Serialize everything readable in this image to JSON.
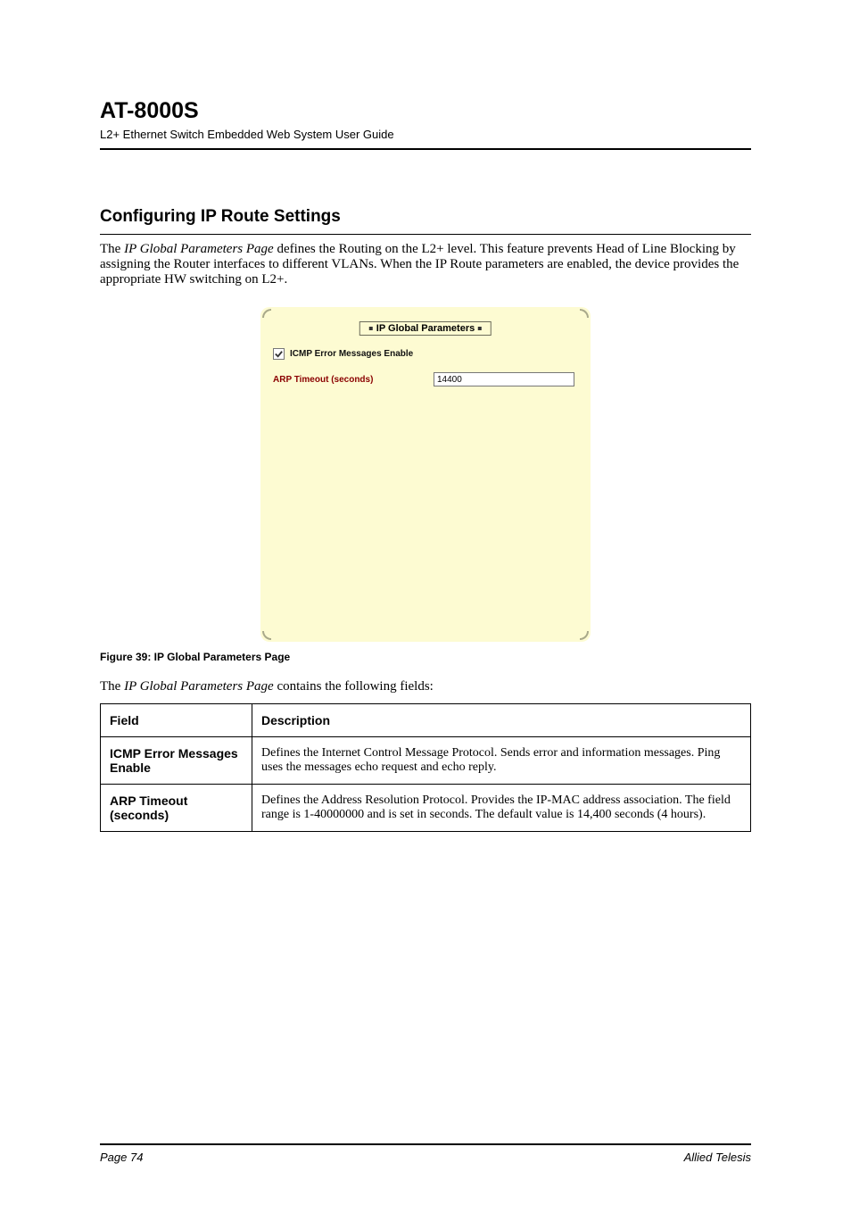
{
  "header": {
    "model": "AT-8000S",
    "subtitle": "L2+ Ethernet Switch Embedded Web System User Guide"
  },
  "section": {
    "title": "Configuring IP Route Settings",
    "intro_prefix": "The ",
    "intro_link": "IP Global Parameters Page",
    "intro_rest": " defines the Routing on the L2+ level. This feature prevents Head of Line Blocking by assigning the Router interfaces to different VLANs. When the IP Route parameters are enabled, the device provides the appropriate HW switching on L2+."
  },
  "panel": {
    "title": "IP Global Parameters",
    "checkbox_label": "ICMP Error Messages Enable",
    "checkbox_checked": true,
    "arp_label": "ARP Timeout (seconds)",
    "arp_value": "14400"
  },
  "figure_caption": "Figure 39: IP Global Parameters Page",
  "lead_in_prefix": "The ",
  "lead_in_link": "IP Global Parameters Page",
  "lead_in_rest": " contains the following fields:",
  "table": {
    "head_field": "Field",
    "head_desc": "Description",
    "rows": [
      {
        "name": "ICMP Error Messages Enable",
        "desc": "Defines the Internet Control Message Protocol. Sends error and information messages. Ping uses the messages echo request and echo reply."
      },
      {
        "name": "ARP Timeout (seconds)",
        "desc": "Defines the Address Resolution Protocol. Provides the IP-MAC address association. The field range is 1-40000000 and is set in seconds. The default value is 14,400 seconds (4 hours)."
      }
    ]
  },
  "footer": {
    "left": "Page 74",
    "right": "Allied Telesis"
  }
}
